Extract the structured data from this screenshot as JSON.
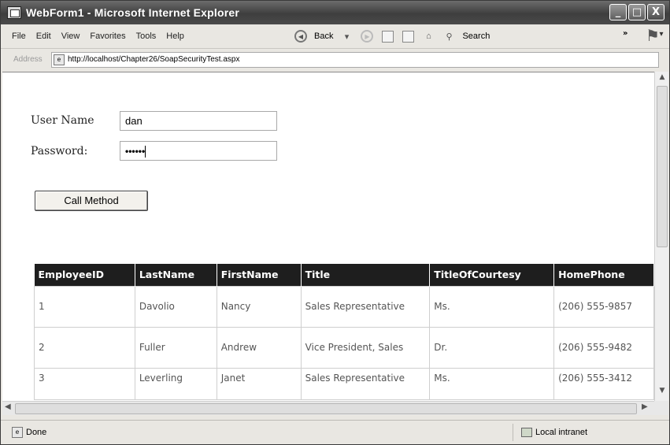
{
  "window": {
    "title": "WebForm1 - Microsoft Internet Explorer",
    "minimize": "_",
    "maximize": "□",
    "close": "X"
  },
  "menu": {
    "items": [
      {
        "label": "File"
      },
      {
        "label": "Edit"
      },
      {
        "label": "View"
      },
      {
        "label": "Favorites"
      },
      {
        "label": "Tools"
      },
      {
        "label": "Help"
      }
    ],
    "back_label": "Back",
    "search_label": "Search",
    "more": "»"
  },
  "address": {
    "label": "Address",
    "url": "http://localhost/Chapter26/SoapSecurityTest.aspx"
  },
  "form": {
    "username_label": "User Name",
    "username_value": "dan",
    "password_label": "Password:",
    "password_value": "••••••",
    "call_button": "Call Method"
  },
  "table": {
    "columns": [
      "EmployeeID",
      "LastName",
      "FirstName",
      "Title",
      "TitleOfCourtesy",
      "HomePhone"
    ],
    "rows": [
      [
        "1",
        "Davolio",
        "Nancy",
        "Sales Representative",
        "Ms.",
        "(206) 555-9857"
      ],
      [
        "2",
        "Fuller",
        "Andrew",
        "Vice President, Sales",
        "Dr.",
        "(206) 555-9482"
      ],
      [
        "3",
        "Leverling",
        "Janet",
        "Sales Representative",
        "Ms.",
        "(206) 555-3412"
      ]
    ]
  },
  "status": {
    "left": "Done",
    "zone": "Local intranet"
  }
}
